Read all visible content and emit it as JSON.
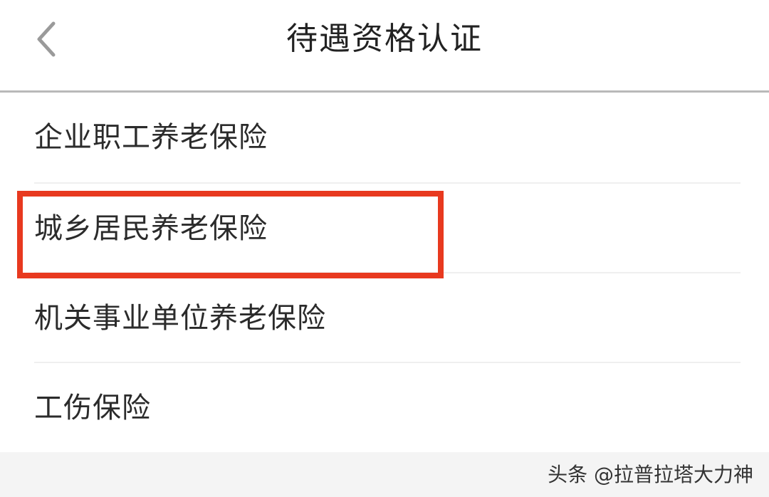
{
  "header": {
    "title": "待遇资格认证",
    "back_icon": "chevron-left-icon"
  },
  "list": {
    "items": [
      {
        "label": "企业职工养老保险"
      },
      {
        "label": "城乡居民养老保险",
        "highlighted": true
      },
      {
        "label": "机关事业单位养老保险"
      },
      {
        "label": "工伤保险"
      }
    ]
  },
  "highlight_color": "#e8391f",
  "watermark": {
    "text": "头条 @拉普拉塔大力神"
  }
}
